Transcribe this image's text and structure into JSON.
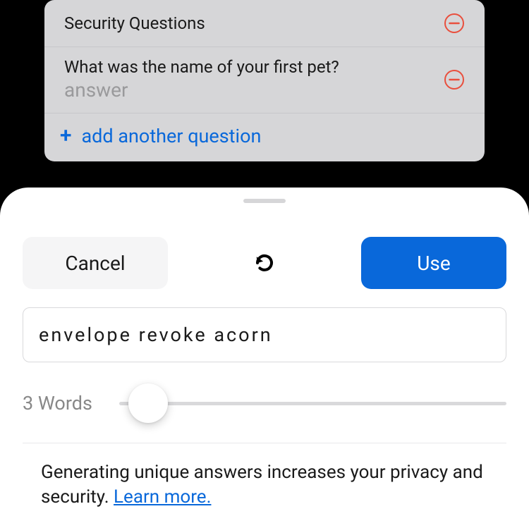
{
  "security": {
    "header": "Security Questions",
    "question": "What was the name of your first pet?",
    "answer_placeholder": "answer",
    "add_label": "add another question"
  },
  "sheet": {
    "cancel_label": "Cancel",
    "use_label": "Use",
    "generated_value": "envelope revoke acorn",
    "word_count_label": "3 Words",
    "info_text": "Generating unique answers increases your privacy and security. ",
    "learn_more_label": "Learn more."
  },
  "colors": {
    "accent": "#0968da",
    "danger": "#e94f3d"
  }
}
